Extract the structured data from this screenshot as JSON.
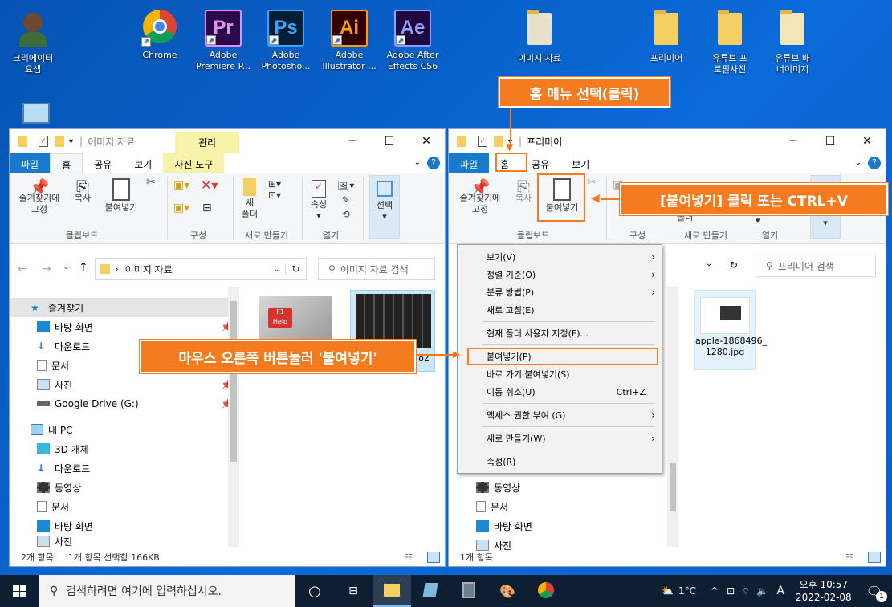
{
  "desktop_icons": [
    {
      "label": "크리에이터\n요셉",
      "x": 0
    },
    {
      "label": "Chrome"
    },
    {
      "label": "Adobe Premiere P...",
      "glyph": "Pr",
      "color": "#2a0a4a",
      "fg": "#e78cff"
    },
    {
      "label": "Adobe Photosho...",
      "glyph": "Ps",
      "color": "#001e36",
      "fg": "#31a8ff"
    },
    {
      "label": "Adobe Illustrator ...",
      "glyph": "Ai",
      "color": "#330000",
      "fg": "#ff9a00"
    },
    {
      "label": "Adobe After Effects CS6",
      "glyph": "Ae",
      "color": "#1f0a40",
      "fg": "#9999ff"
    },
    {
      "label": "이미지 자료"
    },
    {
      "label": "프리미어"
    },
    {
      "label": "유튜브 프로필사진"
    },
    {
      "label": "유튜브 배너이미지"
    }
  ],
  "left_window": {
    "title": "이미지 자료",
    "contextual_header": "관리",
    "tabs": [
      "파일",
      "홈",
      "공유",
      "보기",
      "사진 도구"
    ],
    "ribbon": {
      "pin": "즐겨찾기에\n고정",
      "copy": "복사",
      "paste": "붙여넣기",
      "clipboard_group": "클립보드",
      "organize_group": "구성",
      "new_folder": "새\n폴더",
      "new_group": "새로 만들기",
      "properties": "속성",
      "open_group": "열기",
      "select": "선택"
    },
    "address": "이미지 자료",
    "search_placeholder": "이미지 자료 검색",
    "nav": [
      "즐겨찾기",
      "바탕 화면",
      "다운로드",
      "문서",
      "사진",
      "Google Drive (G:)",
      "내 PC",
      "3D 개체",
      "다운로드",
      "동영상",
      "문서",
      "바탕 화면",
      "사진"
    ],
    "file_partial": "82",
    "status": {
      "count": "2개 항목",
      "selected": "1개 항목 선택함 166KB"
    }
  },
  "right_window": {
    "title": "프리미어",
    "tabs": [
      "파일",
      "홈",
      "공유",
      "보기"
    ],
    "ribbon": {
      "pin": "즐겨찾기에\n고정",
      "copy": "복사",
      "paste": "붙여넣기",
      "clipboard_group": "클립보드",
      "organize_group": "구성",
      "new_folder": "폴더",
      "new_group": "새로 만들기",
      "open_group": "열기"
    },
    "search_placeholder": "프리미어 검색",
    "file_name": "apple-1868496_\n1280.jpg",
    "nav": [
      "동영상",
      "문서",
      "바탕 화면",
      "사진"
    ],
    "status": {
      "count": "1개 항목"
    }
  },
  "context_menu": [
    {
      "label": "보기(V)",
      "arrow": true
    },
    {
      "label": "정렬 기준(O)",
      "arrow": true
    },
    {
      "label": "분류 방법(P)",
      "arrow": true
    },
    {
      "label": "새로 고침(E)"
    },
    {
      "sep": true
    },
    {
      "label": "현재 폴더 사용자 지정(F)..."
    },
    {
      "sep": true
    },
    {
      "label": "붙여넣기(P)",
      "highlight": true
    },
    {
      "label": "바로 가기 붙여넣기(S)"
    },
    {
      "label": "이동 취소(U)",
      "shortcut": "Ctrl+Z"
    },
    {
      "sep": true
    },
    {
      "label": "액세스 권한 부여 (G)",
      "arrow": true
    },
    {
      "sep": true
    },
    {
      "label": "새로 만들기(W)",
      "arrow": true
    },
    {
      "sep": true
    },
    {
      "label": "속성(R)"
    }
  ],
  "callouts": {
    "home_menu": "홈 메뉴 선택(클릭)",
    "paste_ctrl": "[붙여넣기] 클릭 또는 CTRL+V",
    "right_click": "마우스 오른쪽 버튼눌러 '붙여넣기'"
  },
  "taskbar": {
    "search_placeholder": "검색하려면 여기에 입력하십시오.",
    "weather": "1°C",
    "lang": "A",
    "time": "오후 10:57",
    "date": "2022-02-08",
    "notif": "1"
  },
  "colors": {
    "accent": "#f47b20",
    "file_tab": "#1979ca"
  }
}
